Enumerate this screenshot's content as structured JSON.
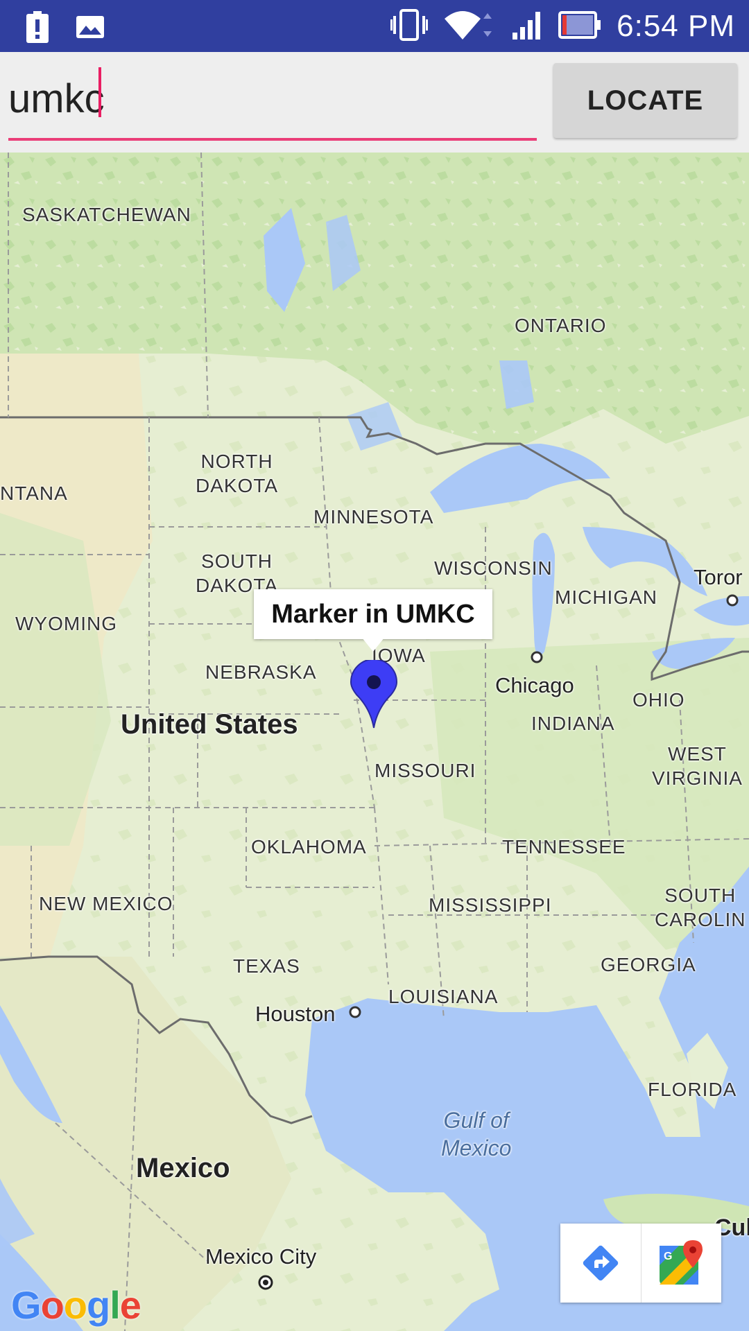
{
  "status_bar": {
    "time": "6:54 PM",
    "icons": [
      "alert-icon",
      "image-icon",
      "vibrate-icon",
      "wifi-icon",
      "signal-icon",
      "battery-icon"
    ]
  },
  "search": {
    "value": "umkc",
    "placeholder": ""
  },
  "locate_button": {
    "label": "LOCATE"
  },
  "map": {
    "labels": {
      "saskatchewan": "SASKATCHEWAN",
      "ontario": "ONTARIO",
      "montana": "NTANA",
      "north_dakota": "NORTH\nDAKOTA",
      "minnesota": "MINNESOTA",
      "south_dakota": "SOUTH\nDAKOTA",
      "wisconsin": "WISCONSIN",
      "michigan": "MICHIGAN",
      "toronto": "Toror",
      "wyoming": "WYOMING",
      "iowa": "IOWA",
      "nebraska": "NEBRASKA",
      "chicago": "Chicago",
      "ohio": "OHIO",
      "indiana": "INDIANA",
      "united_states": "United States",
      "west_virginia": "WEST\nVIRGINIA",
      "missouri": "MISSOURI",
      "oklahoma": "OKLAHOMA",
      "tennessee": "TENNESSEE",
      "new_mexico": "NEW MEXICO",
      "mississippi": "MISSISSIPPI",
      "south_carolina": "SOUTH\nCAROLIN",
      "texas": "TEXAS",
      "georgia": "GEORGIA",
      "louisiana": "LOUISIANA",
      "houston": "Houston",
      "florida": "FLORIDA",
      "gulf": "Gulf of\nMexico",
      "mexico": "Mexico",
      "mexico_city": "Mexico City",
      "cuba": "Cul"
    },
    "marker_title": "Marker in UMKC",
    "marker_color": "#3d3df5",
    "water_color": "#aac8f7",
    "land_color": "#e6efd4",
    "attribution": "Google"
  },
  "toolbar": {
    "directions_icon": "directions-icon",
    "maps_icon": "google-maps-icon"
  }
}
